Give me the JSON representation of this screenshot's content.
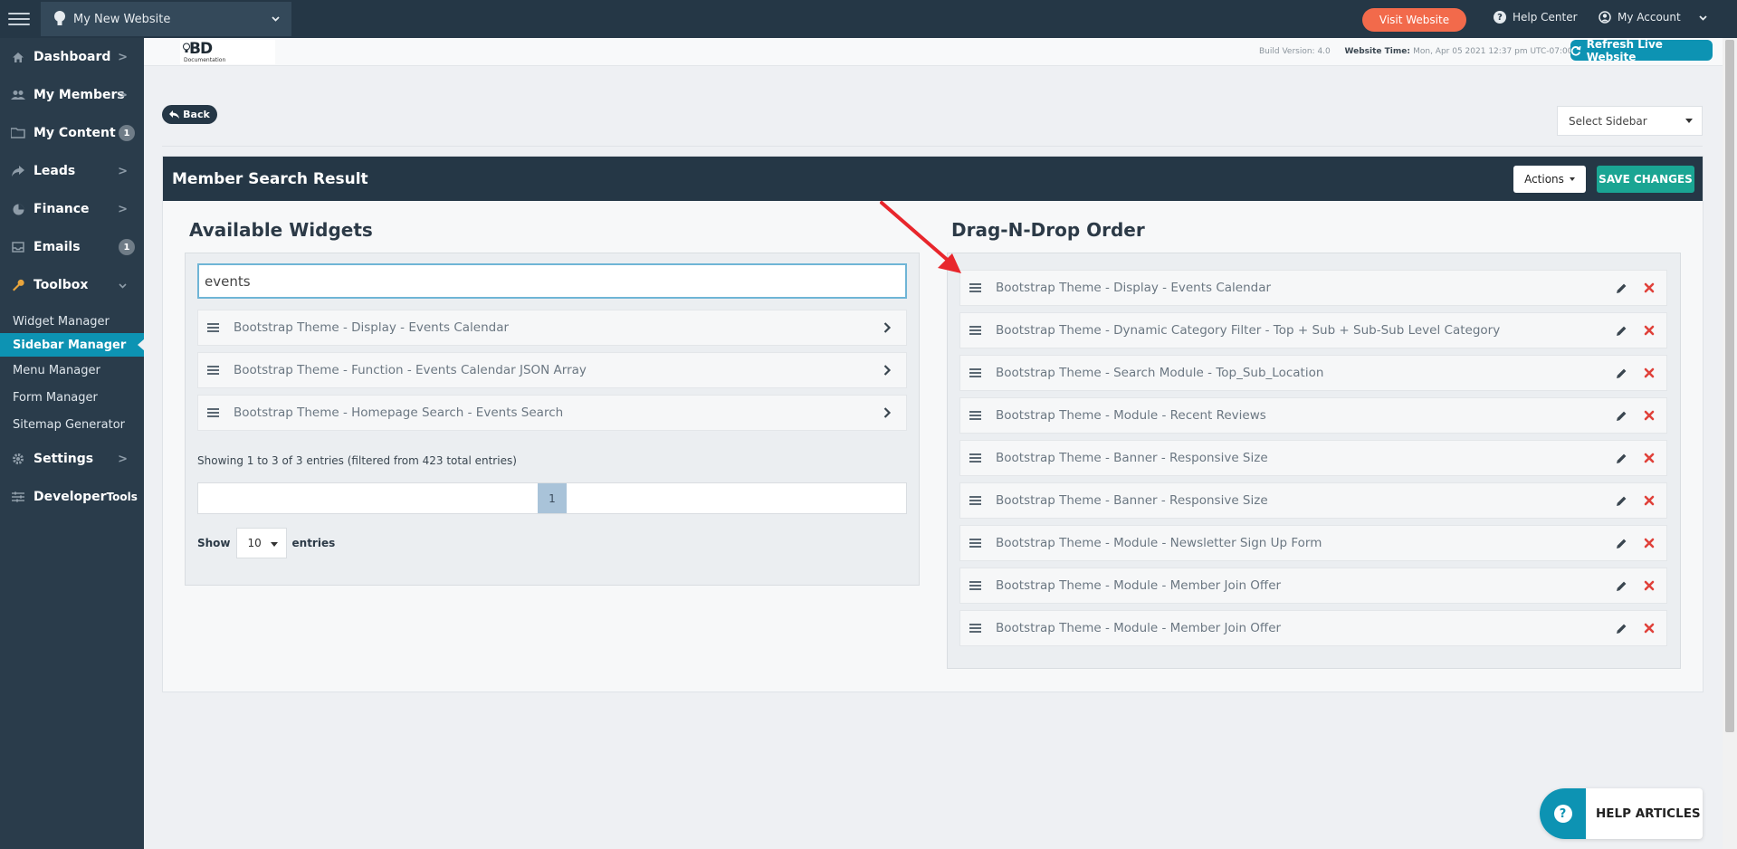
{
  "topbar": {
    "site_name": "My New Website",
    "visit_website": "Visit Website",
    "help_center": "Help Center",
    "my_account": "My Account"
  },
  "sidebar": {
    "items": [
      {
        "label": "Dashboard",
        "icon": "home-icon",
        "chevron": ">",
        "badge": ""
      },
      {
        "label": "My Members",
        "icon": "users-icon",
        "chevron": ">",
        "badge": ""
      },
      {
        "label": "My Content",
        "icon": "folder-icon",
        "chevron": "",
        "badge": "1"
      },
      {
        "label": "Leads",
        "icon": "share-icon",
        "chevron": ">",
        "badge": ""
      },
      {
        "label": "Finance",
        "icon": "pie-chart-icon",
        "chevron": ">",
        "badge": ""
      },
      {
        "label": "Emails",
        "icon": "inbox-icon",
        "chevron": "",
        "badge": "1"
      },
      {
        "label": "Toolbox",
        "icon": "wrench-icon",
        "chevron": "v",
        "badge": ""
      },
      {
        "label": "Settings",
        "icon": "gear-icon",
        "chevron": ">",
        "badge": ""
      }
    ],
    "toolbox_sub": [
      "Widget Manager",
      "Sidebar Manager",
      "Menu Manager",
      "Form Manager",
      "Sitemap Generator"
    ],
    "developer_tools_bold": "Developer",
    "developer_tools_rest": " Tools"
  },
  "header": {
    "logo_text": "BD",
    "logo_sub": "Documentation",
    "build_label": "Build Version: ",
    "build_value": "4.0",
    "website_time_label": "Website Time: ",
    "website_time_value": "Mon, Apr 05 2021 12:37 pm UTC-07:00",
    "refresh_label": "Refresh Live Website"
  },
  "main": {
    "back_label": "Back",
    "select_sidebar": "Select Sidebar",
    "panel_title": "Member Search Result",
    "actions_label": "Actions",
    "save_label": "SAVE CHANGES",
    "available_title": "Available Widgets",
    "order_title": "Drag-N-Drop Order",
    "search_value": "events",
    "available_widgets": [
      "Bootstrap Theme - Display - Events Calendar",
      "Bootstrap Theme - Function - Events Calendar JSON Array",
      "Bootstrap Theme - Homepage Search - Events Search"
    ],
    "info_text": "Showing 1 to 3 of 3 entries (filtered from 423 total entries)",
    "page_number": "1",
    "show_label": "Show",
    "show_value": "10",
    "entries_label": "entries",
    "order_widgets": [
      "Bootstrap Theme - Display - Events Calendar",
      "Bootstrap Theme - Dynamic Category Filter - Top + Sub + Sub-Sub Level Category",
      "Bootstrap Theme - Search Module - Top_Sub_Location",
      "Bootstrap Theme - Module - Recent Reviews",
      "Bootstrap Theme - Banner - Responsive Size",
      "Bootstrap Theme - Banner - Responsive Size",
      "Bootstrap Theme - Module - Newsletter Sign Up Form",
      "Bootstrap Theme - Module - Member Join Offer",
      "Bootstrap Theme - Module - Member Join Offer"
    ]
  },
  "help_articles": "HELP ARTICLES",
  "colors": {
    "sidebar_bg": "#2a3c4b",
    "topbar_bg": "#253746",
    "accent": "#0d93b3",
    "visit_orange": "#f26a4b",
    "save_green": "#1aa593",
    "delete_red": "#e0413a",
    "annotation_red": "#e8262c"
  }
}
